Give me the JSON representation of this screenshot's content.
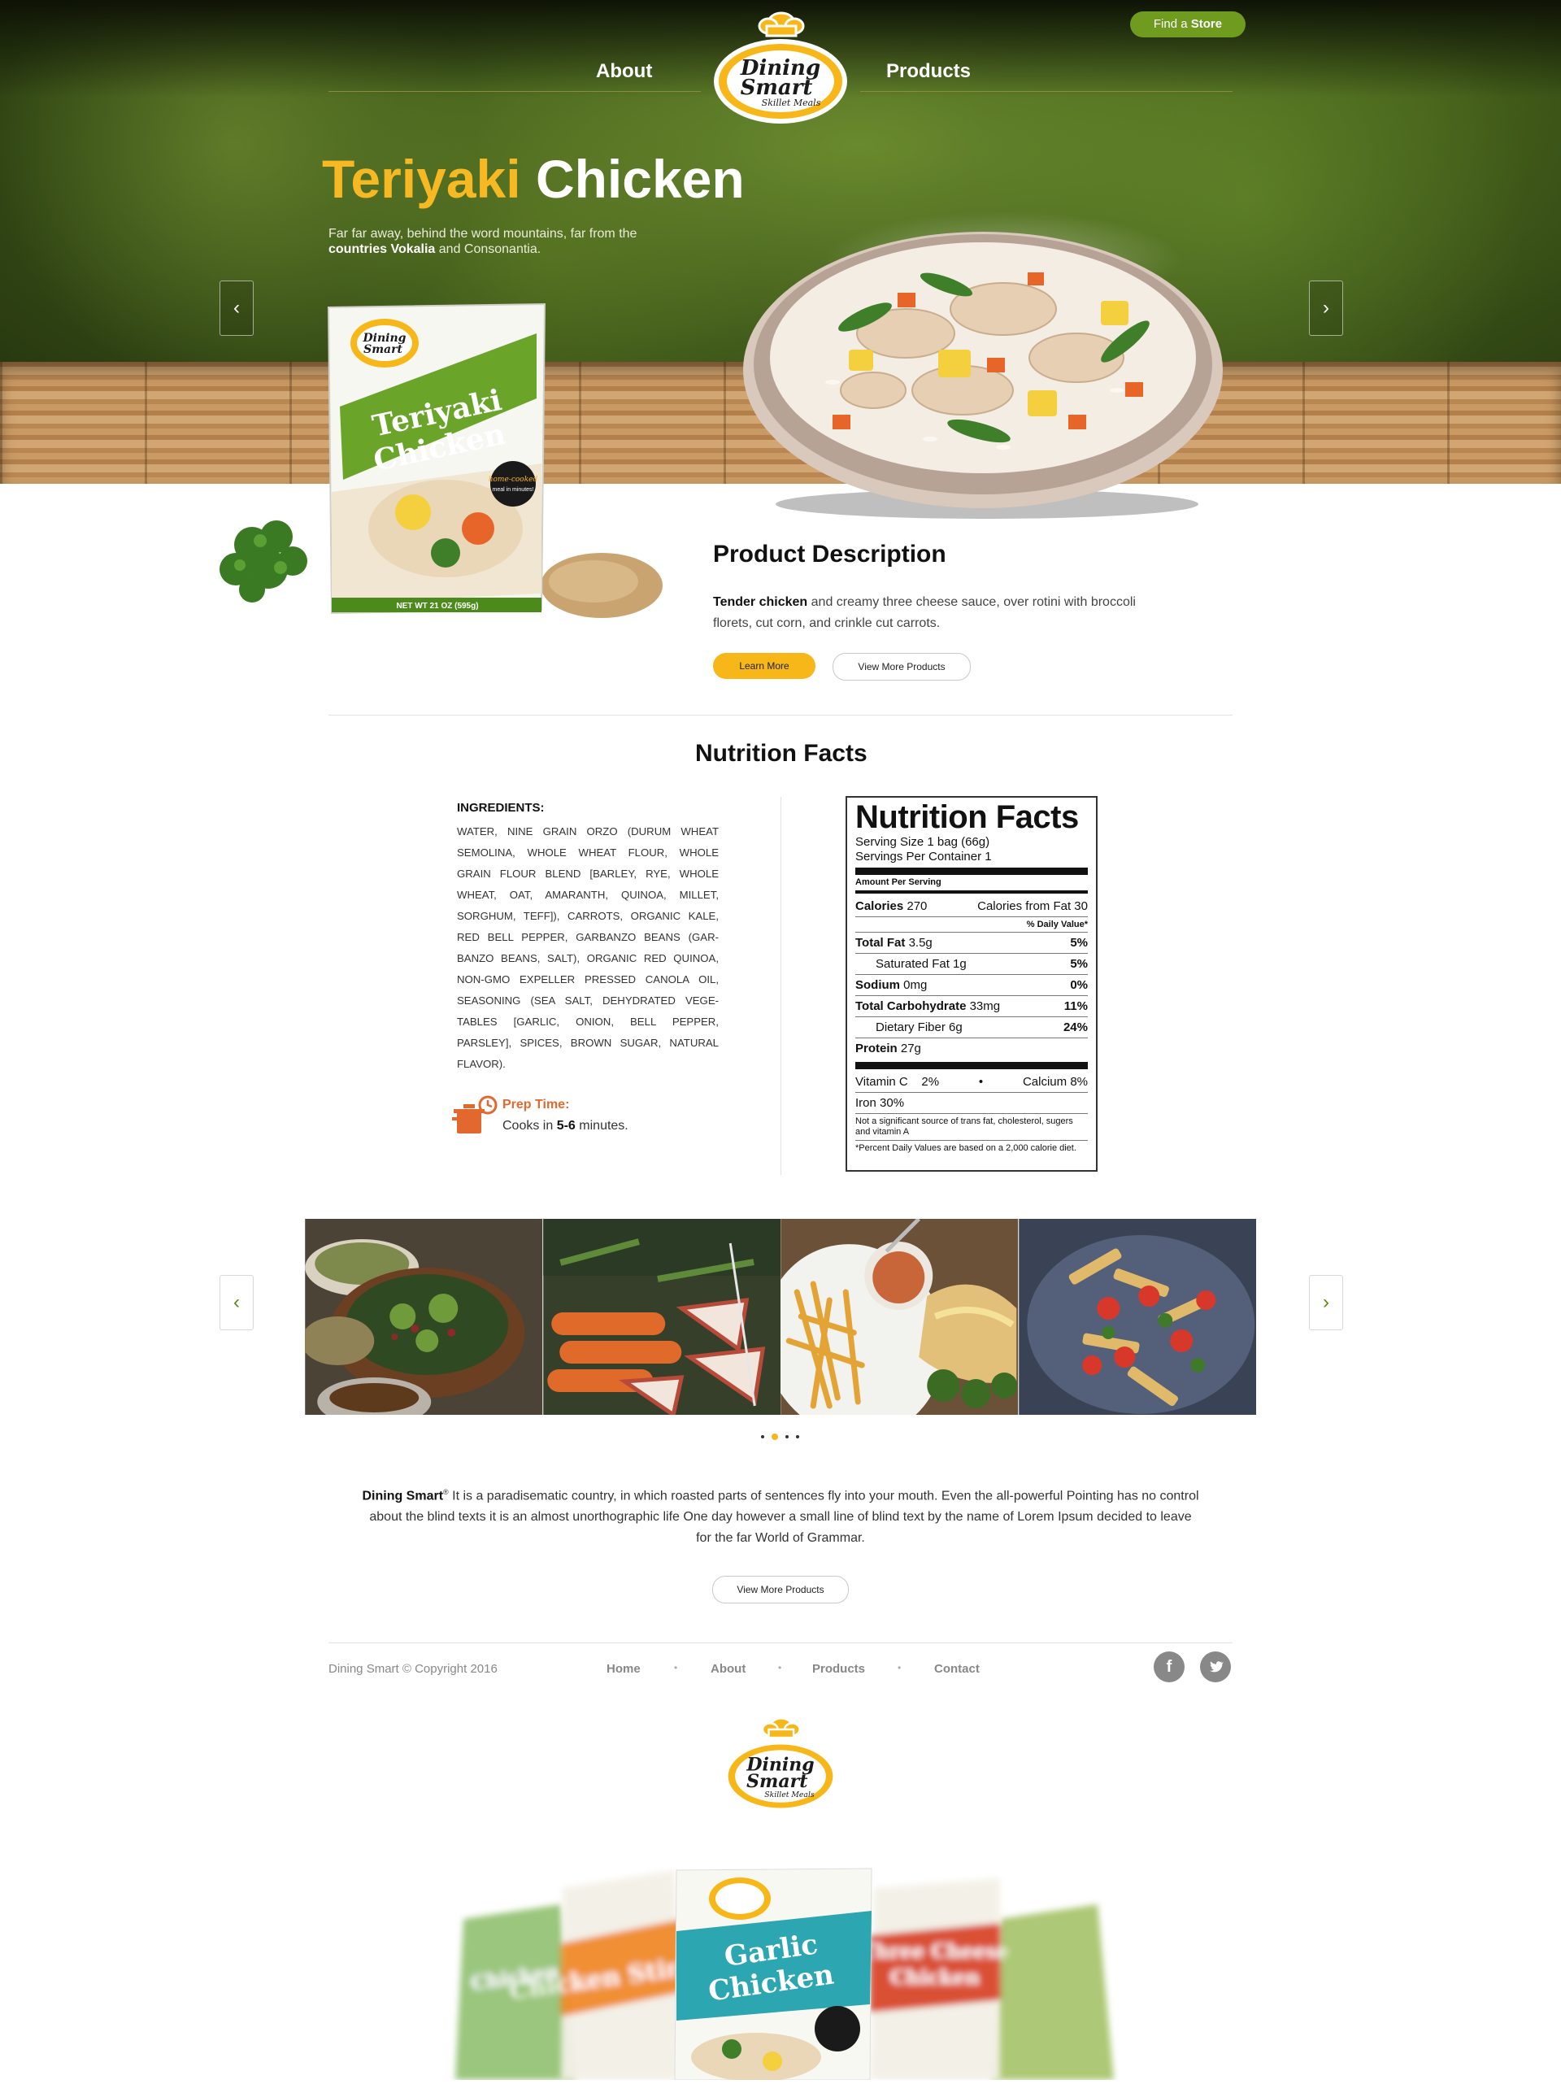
{
  "header": {
    "nav_about": "About",
    "nav_products": "Products",
    "find_store_prefix": "Find a",
    "find_store_bold": "Store",
    "logo_line1": "Dining",
    "logo_line2": "Smart",
    "logo_line3": "Skillet Meals"
  },
  "hero": {
    "title_accent": "Teriyaki",
    "title_rest": "Chicken",
    "subtitle_part1": "Far far away, behind the word mountains, far from the",
    "subtitle_bold": "countries Vokalia",
    "subtitle_part2": "and Consonantia.",
    "prev_icon": "chevron-left-icon",
    "next_icon": "chevron-right-icon",
    "package_brand": "Dining Smart",
    "package_name_1": "Teriyaki",
    "package_name_2": "Chicken",
    "package_badge": "A home-cooked meal in minutes!",
    "package_net_wt": "NET WT 21 OZ (595g)"
  },
  "product": {
    "heading": "Product Description",
    "desc_bold": "Tender chicken",
    "desc_rest": "and creamy three cheese sauce, over rotini with broccoli florets, cut corn, and crinkle cut carrots.",
    "learn_more": "Learn More",
    "view_more": "View More Products"
  },
  "nutrition": {
    "heading": "Nutrition Facts",
    "ingredients_title": "INGREDIENTS:",
    "ingredients_text": "WATER, NINE GRAIN ORZO (DURUM WHEAT SEMOLINA, WHOLE WHEAT FLOUR, WHOLE GRAIN FLOUR BLEND [BARLEY, RYE, WHOLE WHEAT, OAT, AMARANTH, QUINOA, MILLET, SORGHUM, TEFF]), CARROTS, ORGANIC KALE, RED BELL PEPPER, GARBANZO BEANS (GAR- BANZO BEANS, SALT), ORGANIC RED QUINOA, NON-GMO EXPELLER PRESSED CANOLA OIL, SEASONING (SEA SALT, DEHYDRATED VEGE- TABLES [GARLIC, ONION, BELL PEPPER, PARSLEY], SPICES, BROWN SUGAR, NATURAL FLAVOR).",
    "prep_label": "Prep Time:",
    "prep_prefix": "Cooks in",
    "prep_bold": "5-6",
    "prep_suffix": "minutes.",
    "label": {
      "title": "Nutrition Facts",
      "serving_size": "Serving Size 1 bag (66g)",
      "servings": "Servings Per Container 1",
      "amount_per": "Amount Per Serving",
      "calories_label": "Calories",
      "calories_value": "270",
      "calories_fat": "Calories from Fat 30",
      "dv_header": "% Daily Value*",
      "total_fat_label": "Total Fat",
      "total_fat_value": "3.5g",
      "total_fat_dv": "5%",
      "sat_fat_label": "Saturated Fat 1g",
      "sat_fat_dv": "5%",
      "sodium_label": "Sodium",
      "sodium_value": "0mg",
      "sodium_dv": "0%",
      "carb_label": "Total Carbohydrate",
      "carb_value": "33mg",
      "carb_dv": "11%",
      "fiber_label": "Dietary Fiber 6g",
      "fiber_dv": "24%",
      "protein_label": "Protein",
      "protein_value": "27g",
      "vitamin_c": "Vitamin C    2%",
      "bullet": "•",
      "calcium": "Calcium 8%",
      "iron": "Iron 30%",
      "note1": "Not a significant source of trans fat, cholesterol, sugers and vitamin A",
      "note2": "*Percent Daily Values are based on a 2,000 calorie diet."
    }
  },
  "gallery": {
    "images": [
      "salad-bowls-image",
      "carrots-apples-image",
      "fries-quesadilla-image",
      "pasta-tomato-image"
    ],
    "prev_icon": "chevron-left-icon",
    "next_icon": "chevron-right-icon",
    "active_dot": 1,
    "dot_count": 4
  },
  "about": {
    "brand": "Dining Smart",
    "reg": "®",
    "text": "It is a paradisematic country, in which roasted parts of sentences fly into your mouth. Even the all-powerful Pointing has no control about the blind texts it is an almost unorthographic life One day however a small line of blind text by the name of Lorem Ipsum decided to leave for the far World of Grammar.",
    "view_more": "View More Products"
  },
  "footer": {
    "copyright": "Dining Smart © Copyright 2016",
    "links": [
      "Home",
      "About",
      "Products",
      "Contact"
    ],
    "separator": "•",
    "facebook_glyph": "f",
    "twitter_glyph": "t"
  },
  "bags": {
    "left_far": "Chicken",
    "left": "Chicken Stir-Fry",
    "center_line1": "Garlic",
    "center_line2": "Chicken",
    "right_line1": "Three Cheese",
    "right_line2": "Chicken"
  },
  "colors": {
    "accent_yellow": "#f7b719",
    "brand_green": "#6f9b1f",
    "prep_orange": "#e2682e"
  }
}
